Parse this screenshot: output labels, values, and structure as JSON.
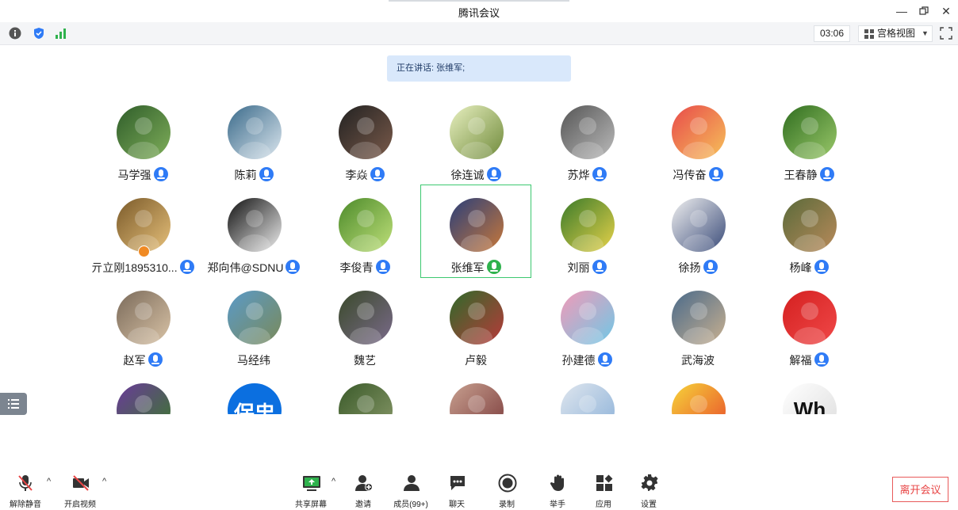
{
  "window": {
    "title": "腾讯会议"
  },
  "toolbar": {
    "timer": "03:06",
    "view_label": "宫格视图"
  },
  "speaking": {
    "text": "正在讲话: 张维军;"
  },
  "participants": [
    {
      "name": "马学强",
      "mic": "on"
    },
    {
      "name": "陈莉",
      "mic": "on"
    },
    {
      "name": "李焱",
      "mic": "on"
    },
    {
      "name": "徐连诚",
      "mic": "on"
    },
    {
      "name": "苏烨",
      "mic": "on"
    },
    {
      "name": "冯传奋",
      "mic": "on"
    },
    {
      "name": "王春静",
      "mic": "on"
    },
    {
      "name": "亓立刚1895310...",
      "mic": "on",
      "host": true
    },
    {
      "name": "郑向伟@SDNU",
      "mic": "on"
    },
    {
      "name": "李俊青",
      "mic": "on"
    },
    {
      "name": "张维军",
      "mic": "speaking",
      "active": true
    },
    {
      "name": "刘丽",
      "mic": "on"
    },
    {
      "name": "徐扬",
      "mic": "on"
    },
    {
      "name": "杨峰",
      "mic": "on"
    },
    {
      "name": "赵军",
      "mic": "on"
    },
    {
      "name": "马经纬",
      "mic": "none"
    },
    {
      "name": "魏艺",
      "mic": "none"
    },
    {
      "name": "卢毅",
      "mic": "none"
    },
    {
      "name": "孙建德",
      "mic": "on"
    },
    {
      "name": "武海波",
      "mic": "none"
    },
    {
      "name": "解福",
      "mic": "on"
    },
    {
      "name": "",
      "mic": "none"
    },
    {
      "name": "",
      "mic": "none",
      "avatar_text": "保忠"
    },
    {
      "name": "",
      "mic": "none"
    },
    {
      "name": "",
      "mic": "none"
    },
    {
      "name": "",
      "mic": "none"
    },
    {
      "name": "",
      "mic": "none"
    },
    {
      "name": "",
      "mic": "none",
      "avatar_text": "Wh"
    }
  ],
  "bottom": {
    "unmute": "解除静音",
    "video": "开启视频",
    "share": "共享屏幕",
    "invite": "邀请",
    "members": "成员(99+)",
    "chat": "聊天",
    "record": "录制",
    "raise_hand": "举手",
    "apps": "应用",
    "settings": "设置",
    "leave": "离开会议"
  },
  "colors": {
    "accent": "#2f7bf6",
    "speaking_bg": "#d9e8fb",
    "active_border": "#3cc870",
    "leave": "#e84545"
  }
}
